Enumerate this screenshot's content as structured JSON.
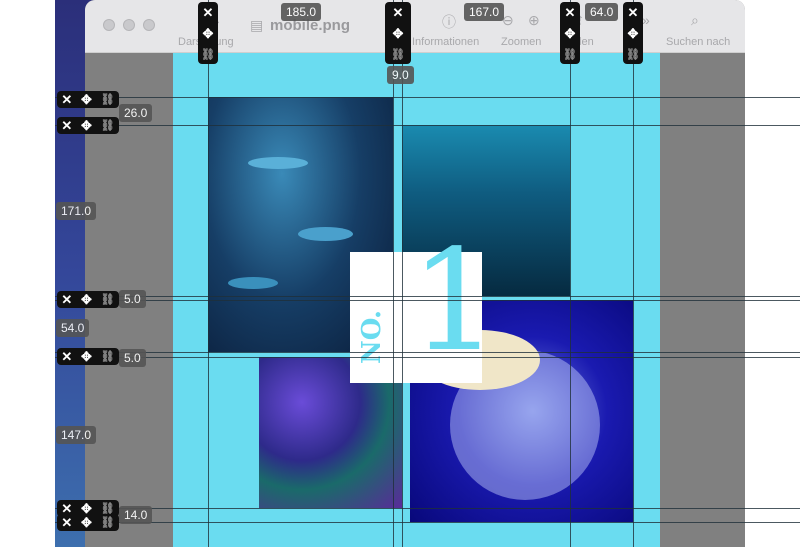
{
  "window": {
    "title": "mobile.png",
    "toolbar": [
      "Darstellung",
      "Informationen",
      "Zoomen",
      "Teilen",
      "Suchen nach"
    ]
  },
  "measurements": {
    "top": [
      "185.0",
      "167.0",
      "64.0",
      "9.0"
    ],
    "left": [
      "26.0",
      "171.0",
      "5.0",
      "54.0",
      "5.0",
      "147.0",
      "14.0"
    ]
  },
  "card": {
    "prefix": "NO.",
    "number": "1"
  },
  "colors": {
    "canvas": "#6adcf0",
    "gray": "#808080"
  }
}
